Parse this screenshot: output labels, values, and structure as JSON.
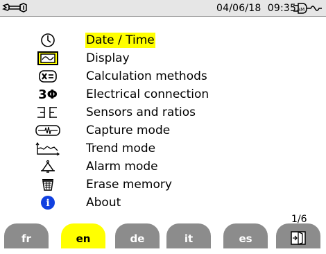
{
  "status_bar": {
    "date": "04/06/18",
    "time": "09:35",
    "ampm": "AM",
    "tool_icon": "wrench-icon",
    "power_icon": "plug-icon"
  },
  "menu": {
    "selected_index": 0,
    "items": [
      {
        "label": "Date / Time",
        "icon": "clock-icon"
      },
      {
        "label": "Display",
        "icon": "display-icon"
      },
      {
        "label": "Calculation methods",
        "icon": "calculation-icon"
      },
      {
        "label": "Electrical connection",
        "icon": "three-phase-icon",
        "glyph": "3Φ"
      },
      {
        "label": "Sensors and ratios",
        "icon": "sensor-icon"
      },
      {
        "label": "Capture mode",
        "icon": "capture-icon"
      },
      {
        "label": "Trend mode",
        "icon": "trend-icon"
      },
      {
        "label": "Alarm mode",
        "icon": "alarm-icon"
      },
      {
        "label": "Erase memory",
        "icon": "erase-icon"
      },
      {
        "label": "About",
        "icon": "info-icon",
        "glyph": "i"
      }
    ]
  },
  "pagination": "1/6",
  "language_tabs": [
    {
      "label": "fr",
      "active": false
    },
    {
      "label": "en",
      "active": true
    },
    {
      "label": "de",
      "active": false
    },
    {
      "label": "it",
      "active": false
    },
    {
      "label": "es",
      "active": false
    }
  ],
  "exit_tab_icon": "exit-icon",
  "colors": {
    "selected": "#ffff00",
    "tab_inactive": "#8c8c8c",
    "info_blue": "#1040e0"
  }
}
